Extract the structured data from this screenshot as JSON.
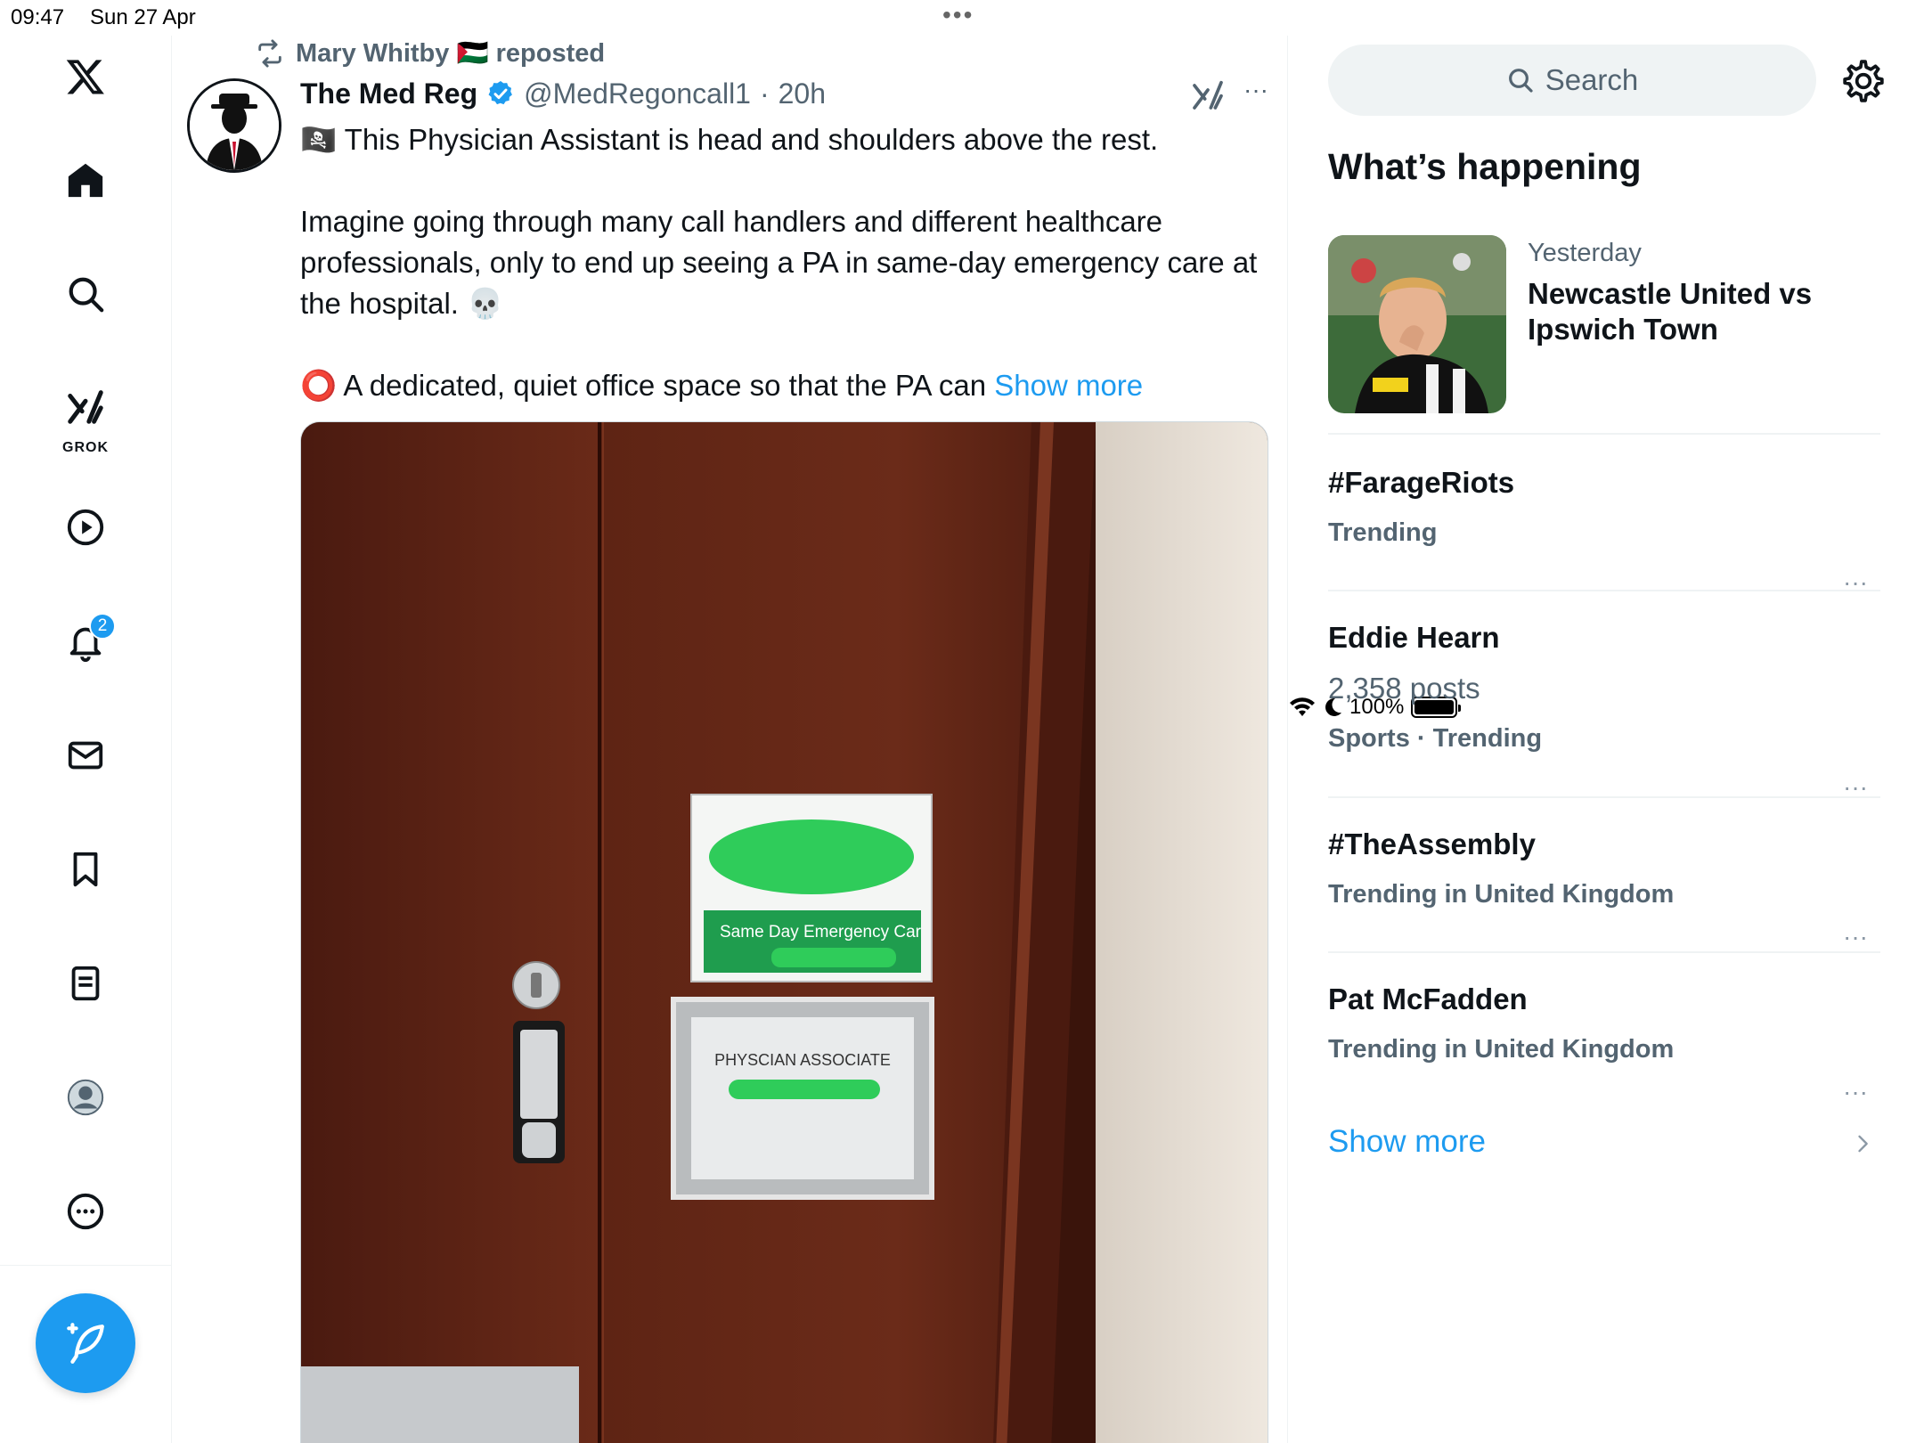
{
  "status_bar": {
    "time": "09:47",
    "date": "Sun 27 Apr",
    "battery": "100%"
  },
  "nav": {
    "items": [
      "x-logo",
      "home-icon",
      "explore-icon",
      "grok-icon",
      "video-icon",
      "notifications-icon",
      "messages-icon",
      "bookmarks-icon",
      "lists-icon",
      "profile-icon",
      "more-icon"
    ],
    "grok_label": "GROK",
    "notification_count": "2"
  },
  "tweet": {
    "reposted_by": "Mary Whitby 🇵🇸 reposted",
    "author_name": "The Med Reg",
    "author_handle": "@MedRegoncall1",
    "separator": "·",
    "time": "20h",
    "line1": "🏴‍☠️ This Physician Assistant is head and shoulders above the rest.",
    "line2": "Imagine going through many call handlers and different healthcare professionals, only to end up seeing a PA in same-day emergency care at the hospital. 💀",
    "line3": "⭕ A dedicated, quiet office space so that the PA can ",
    "show_more": "Show more",
    "image": {
      "sign_top": "Same Day Emergency Car",
      "sign_bottom": "PHYSCIAN ASSOCIATE"
    }
  },
  "sidebar": {
    "search_placeholder": "Search",
    "section_title": "What’s happening",
    "news": {
      "when": "Yesterday",
      "headline": "Newcastle United vs Ipswich Town"
    },
    "trends": [
      {
        "title": "#FarageRiots",
        "meta": "Trending"
      },
      {
        "title": "Eddie Hearn",
        "posts": "2,358 posts",
        "meta": "Sports · Trending"
      },
      {
        "title": "#TheAssembly",
        "meta": "Trending in United Kingdom"
      },
      {
        "title": "Pat McFadden",
        "meta": "Trending in United Kingdom"
      }
    ],
    "show_more": "Show more"
  },
  "colors": {
    "accent": "#1d9bf0",
    "secondary_text": "#536471",
    "primary_text": "#0f1419",
    "door": "#5a2416",
    "sign_green": "#1f9d4e"
  }
}
